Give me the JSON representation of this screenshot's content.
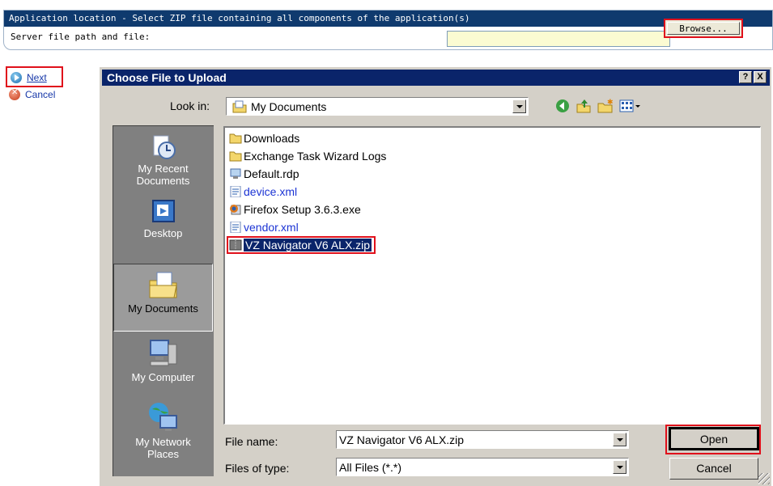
{
  "app": {
    "header_text": "Application location - Select ZIP file containing all components of the application(s)",
    "server_label": "Server file path and file:",
    "server_path_value": "",
    "browse_label": "Browse..."
  },
  "links": {
    "next_label": "Next",
    "cancel_label": "Cancel"
  },
  "dialog": {
    "title": "Choose File to Upload",
    "help_label": "?",
    "close_label": "X",
    "look_in_label": "Look in:",
    "look_in_value": "My Documents",
    "toolbar_icons": [
      "back-icon",
      "up-folder-icon",
      "new-folder-icon",
      "view-menu-icon"
    ],
    "places": [
      {
        "label": "My Recent Documents",
        "icon": "recent-documents-icon"
      },
      {
        "label": "Desktop",
        "icon": "desktop-icon"
      },
      {
        "label": "My Documents",
        "icon": "my-documents-icon",
        "selected": true
      },
      {
        "label": "My Computer",
        "icon": "my-computer-icon"
      },
      {
        "label": "My Network Places",
        "icon": "network-places-icon"
      }
    ],
    "files": [
      {
        "name": "Downloads",
        "type": "folder"
      },
      {
        "name": "Exchange Task Wizard Logs",
        "type": "folder"
      },
      {
        "name": "Default.rdp",
        "type": "rdp"
      },
      {
        "name": "device.xml",
        "type": "xml"
      },
      {
        "name": "Firefox Setup 3.6.3.exe",
        "type": "exe"
      },
      {
        "name": "vendor.xml",
        "type": "xml"
      },
      {
        "name": "VZ Navigator V6 ALX.zip",
        "type": "zip",
        "selected": true
      }
    ],
    "file_name_label": "File name:",
    "file_name_value": "VZ Navigator V6 ALX.zip",
    "files_of_type_label": "Files of type:",
    "files_of_type_value": "All Files (*.*)",
    "open_label": "Open",
    "cancel_label": "Cancel"
  },
  "colors": {
    "header_blue": "#0f3a6e",
    "titlebar_blue": "#0a246a",
    "highlight_red": "#e0101b",
    "dialog_gray": "#d4d0c8",
    "input_yellow": "#fbfbd2"
  }
}
